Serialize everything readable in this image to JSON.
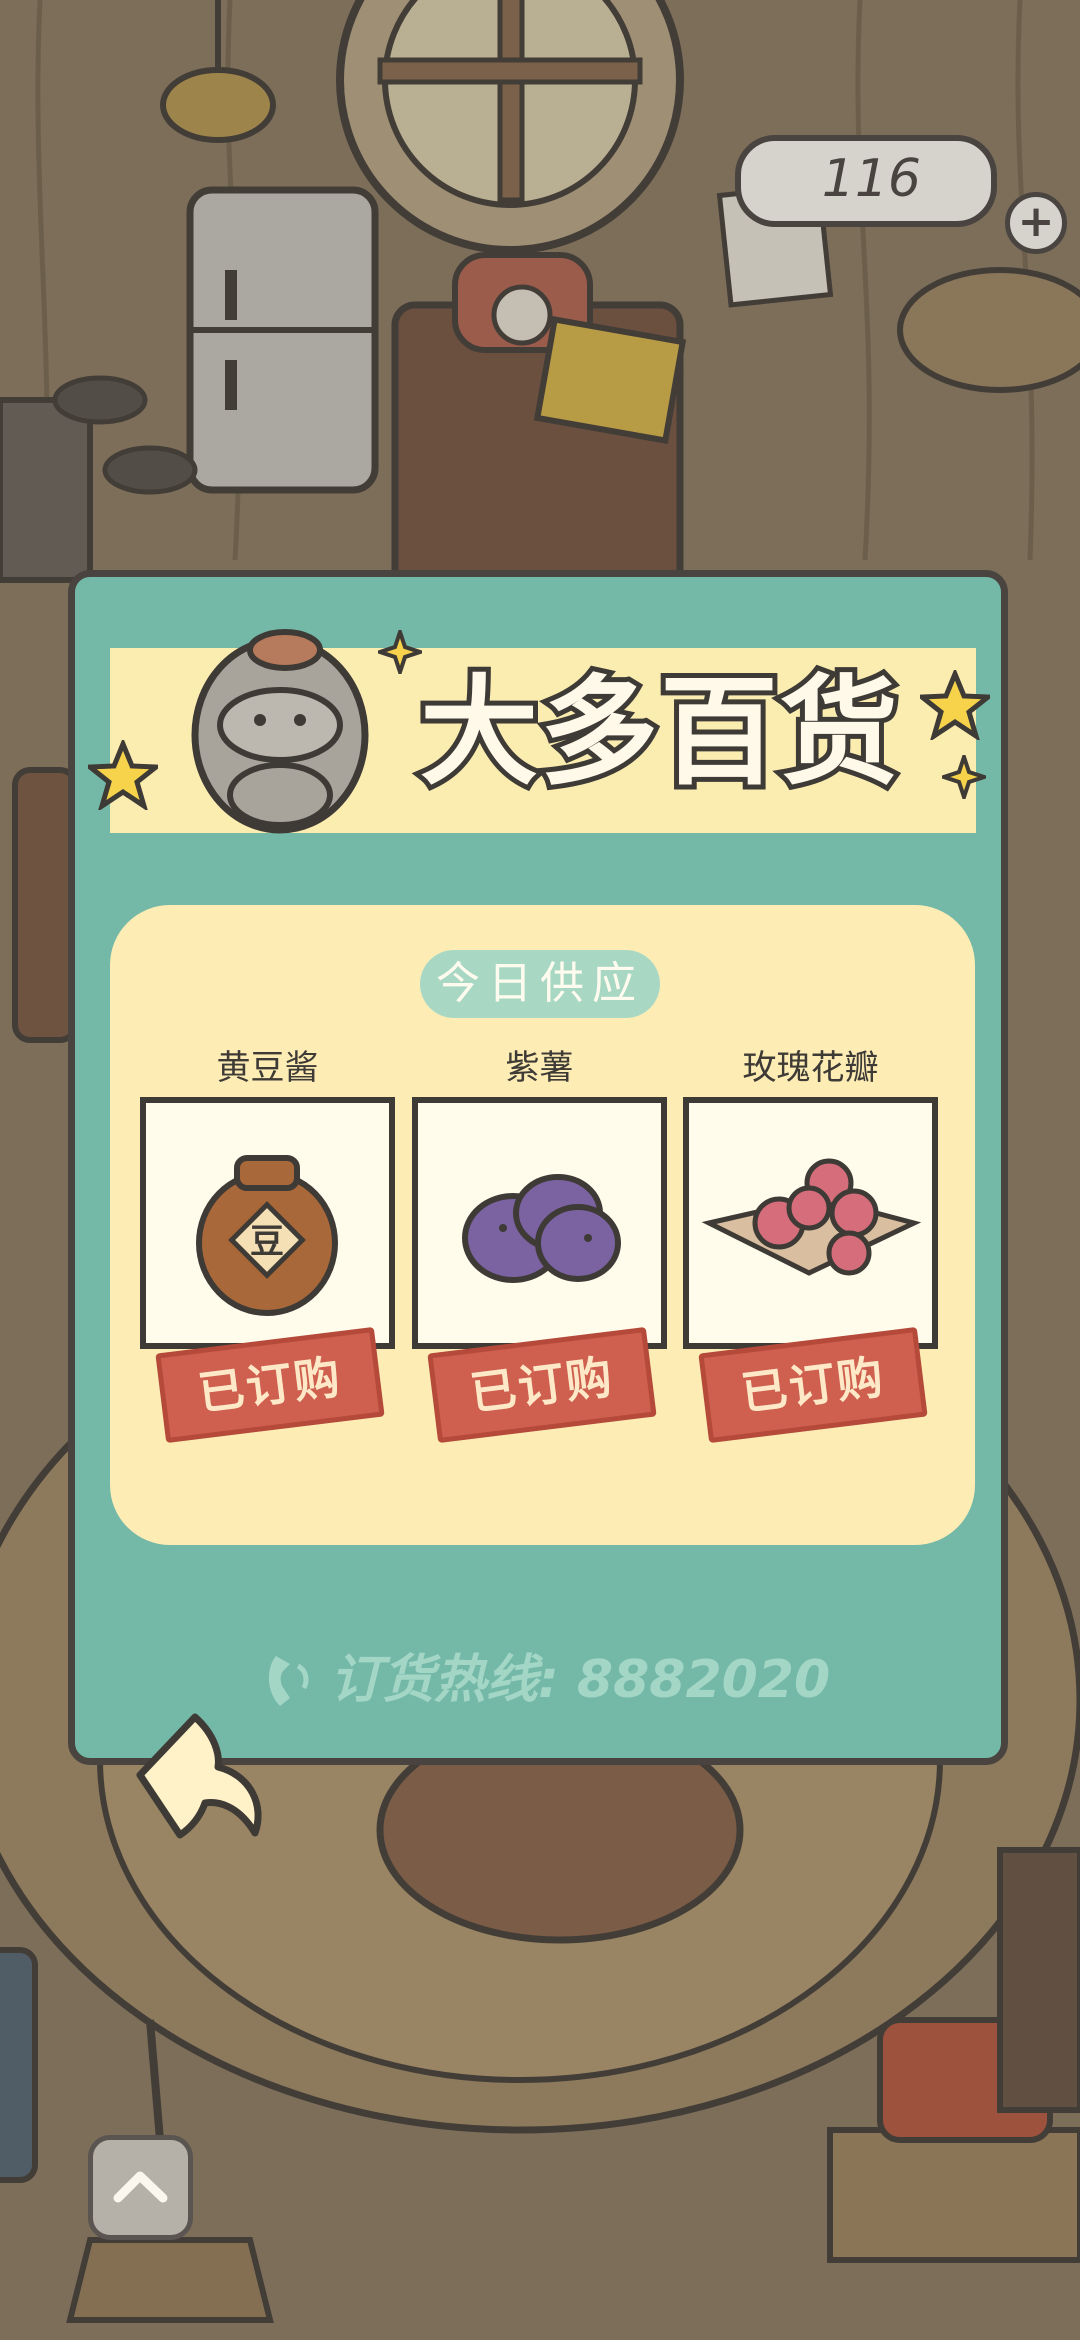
{
  "hud": {
    "currency_count": "116",
    "add_icon": "plus-icon"
  },
  "shop": {
    "title": "大多百货",
    "section_label": "今日供应",
    "items": [
      {
        "name": "黄豆酱",
        "status": "已订购",
        "icon": "soybean-paste-jar-icon",
        "jar_label": "豆"
      },
      {
        "name": "紫薯",
        "status": "已订购",
        "icon": "purple-sweet-potato-icon"
      },
      {
        "name": "玫瑰花瓣",
        "status": "已订购",
        "icon": "rose-petals-icon"
      }
    ],
    "hotline": "订货热线: 8882020"
  },
  "colors": {
    "panel": "#74b8a8",
    "title_band": "#fbecb0",
    "cream": "#fdedb5",
    "ordered_stamp": "#cf5f4e",
    "outline": "#4a4440"
  }
}
